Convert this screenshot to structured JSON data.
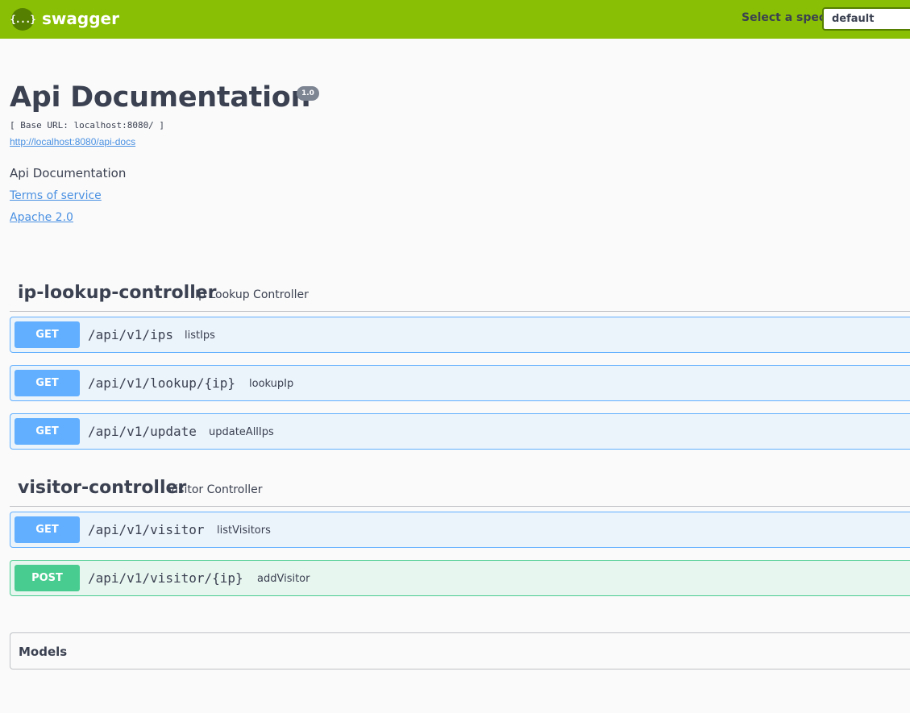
{
  "topbar": {
    "logo_glyph": "{...}",
    "brand": "swagger",
    "spec_label": "Select a spec",
    "spec_selected": "default"
  },
  "info": {
    "title": "Api Documentation",
    "version": "1.0",
    "base_url": "[ Base URL: localhost:8080/ ]",
    "docs_url": "http://localhost:8080/api-docs",
    "description": "Api Documentation",
    "terms": "Terms of service",
    "license": "Apache 2.0"
  },
  "tags": [
    {
      "name": "ip-lookup-controller",
      "description": "Ip Lookup Controller",
      "operations": [
        {
          "method": "GET",
          "path": "/api/v1/ips",
          "summary": "listIps"
        },
        {
          "method": "GET",
          "path": "/api/v1/lookup/{ip}",
          "summary": "lookupIp"
        },
        {
          "method": "GET",
          "path": "/api/v1/update",
          "summary": "updateAllIps"
        }
      ]
    },
    {
      "name": "visitor-controller",
      "description": "Visitor Controller",
      "operations": [
        {
          "method": "GET",
          "path": "/api/v1/visitor",
          "summary": "listVisitors"
        },
        {
          "method": "POST",
          "path": "/api/v1/visitor/{ip}",
          "summary": "addVisitor"
        }
      ]
    }
  ],
  "models": {
    "title": "Models"
  },
  "colors": {
    "topbar": "#89bf04",
    "get": "#61affe",
    "post": "#49cc90",
    "link": "#4990e2"
  }
}
